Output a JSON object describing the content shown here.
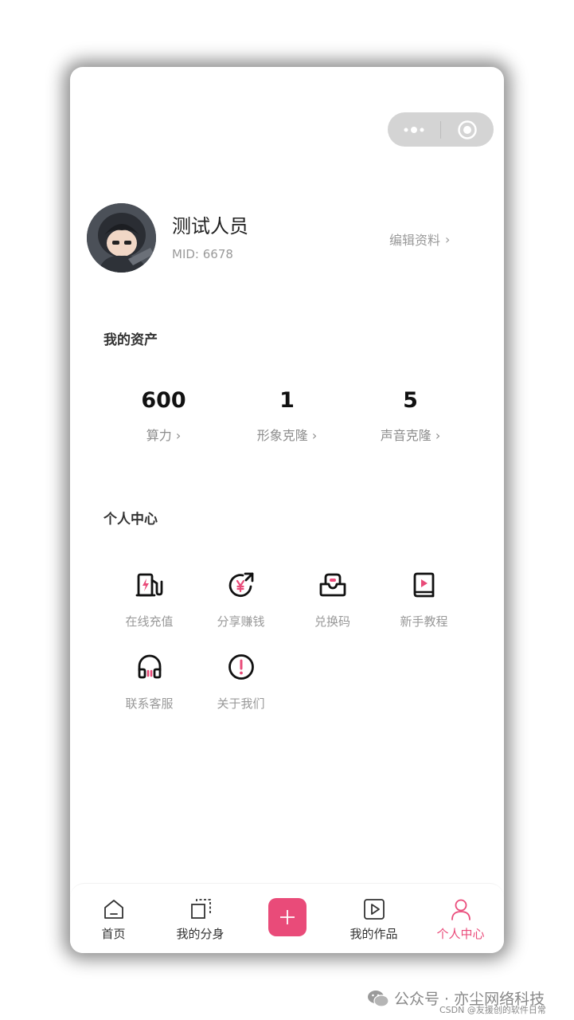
{
  "capsule": {
    "more_icon": "more-dots-icon",
    "close_icon": "target-close-icon"
  },
  "profile": {
    "name": "测试人员",
    "mid": "MID: 6678",
    "edit_label": "编辑资料",
    "edit_chevron": "›"
  },
  "assets": {
    "title": "我的资产",
    "items": [
      {
        "value": "600",
        "label": "算力 ›"
      },
      {
        "value": "1",
        "label": "形象克隆 ›"
      },
      {
        "value": "5",
        "label": "声音克隆 ›"
      }
    ]
  },
  "personal_center": {
    "title": "个人中心",
    "items": [
      {
        "label": "在线充值",
        "icon": "charge-station-icon"
      },
      {
        "label": "分享赚钱",
        "icon": "share-money-icon"
      },
      {
        "label": "兑换码",
        "icon": "redeem-code-icon"
      },
      {
        "label": "新手教程",
        "icon": "tutorial-book-icon"
      },
      {
        "label": "联系客服",
        "icon": "headset-icon"
      },
      {
        "label": "关于我们",
        "icon": "about-info-icon"
      }
    ]
  },
  "tabbar": {
    "items": [
      {
        "label": "首页",
        "icon": "home-icon"
      },
      {
        "label": "我的分身",
        "icon": "clone-icon"
      },
      {
        "label": "",
        "icon": "plus-icon"
      },
      {
        "label": "我的作品",
        "icon": "play-icon"
      },
      {
        "label": "个人中心",
        "icon": "user-icon"
      }
    ],
    "active_index": 4
  },
  "watermark": {
    "line1": "公众号 · 亦尘网络科技",
    "line2": "CSDN @友援创的软件日常"
  },
  "colors": {
    "accent": "#e94b79",
    "text_muted": "#999999"
  }
}
